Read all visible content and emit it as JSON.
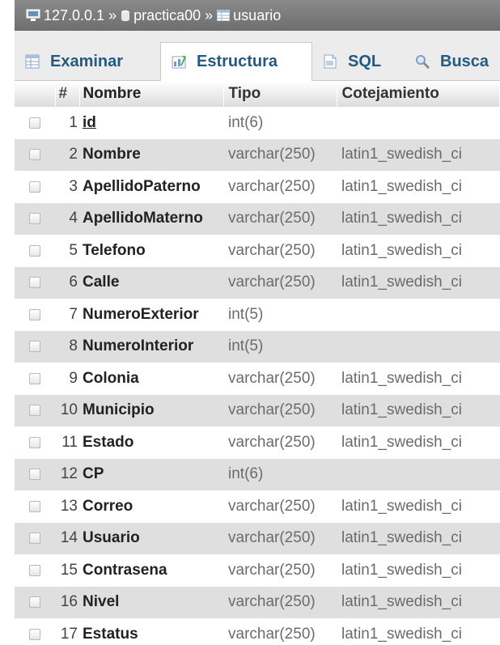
{
  "breadcrumb": {
    "server": "127.0.0.1",
    "database": "practica00",
    "table": "usuario",
    "separator": "»"
  },
  "tabs": [
    {
      "label": "Examinar",
      "icon": "browse-icon"
    },
    {
      "label": "Estructura",
      "icon": "structure-icon",
      "active": true
    },
    {
      "label": "SQL",
      "icon": "sql-icon"
    },
    {
      "label": "Busca",
      "icon": "search-icon"
    }
  ],
  "columns": {
    "number": "#",
    "name": "Nombre",
    "type": "Tipo",
    "collation": "Cotejamiento"
  },
  "rows": [
    {
      "num": "1",
      "name": "id",
      "type": "int(6)",
      "collation": ""
    },
    {
      "num": "2",
      "name": "Nombre",
      "type": "varchar(250)",
      "collation": "latin1_swedish_ci"
    },
    {
      "num": "3",
      "name": "ApellidoPaterno",
      "type": "varchar(250)",
      "collation": "latin1_swedish_ci"
    },
    {
      "num": "4",
      "name": "ApellidoMaterno",
      "type": "varchar(250)",
      "collation": "latin1_swedish_ci"
    },
    {
      "num": "5",
      "name": "Telefono",
      "type": "varchar(250)",
      "collation": "latin1_swedish_ci"
    },
    {
      "num": "6",
      "name": "Calle",
      "type": "varchar(250)",
      "collation": "latin1_swedish_ci"
    },
    {
      "num": "7",
      "name": "NumeroExterior",
      "type": "int(5)",
      "collation": ""
    },
    {
      "num": "8",
      "name": "NumeroInterior",
      "type": "int(5)",
      "collation": ""
    },
    {
      "num": "9",
      "name": "Colonia",
      "type": "varchar(250)",
      "collation": "latin1_swedish_ci"
    },
    {
      "num": "10",
      "name": "Municipio",
      "type": "varchar(250)",
      "collation": "latin1_swedish_ci"
    },
    {
      "num": "11",
      "name": "Estado",
      "type": "varchar(250)",
      "collation": "latin1_swedish_ci"
    },
    {
      "num": "12",
      "name": "CP",
      "type": "int(6)",
      "collation": ""
    },
    {
      "num": "13",
      "name": "Correo",
      "type": "varchar(250)",
      "collation": "latin1_swedish_ci"
    },
    {
      "num": "14",
      "name": "Usuario",
      "type": "varchar(250)",
      "collation": "latin1_swedish_ci"
    },
    {
      "num": "15",
      "name": "Contrasena",
      "type": "varchar(250)",
      "collation": "latin1_swedish_ci"
    },
    {
      "num": "16",
      "name": "Nivel",
      "type": "varchar(250)",
      "collation": "latin1_swedish_ci"
    },
    {
      "num": "17",
      "name": "Estatus",
      "type": "varchar(250)",
      "collation": "latin1_swedish_ci"
    }
  ],
  "colors": {
    "breadcrumb_bg": "#7a7a7a",
    "tab_text": "#235a81",
    "row_alt": "#dfdfdf"
  }
}
